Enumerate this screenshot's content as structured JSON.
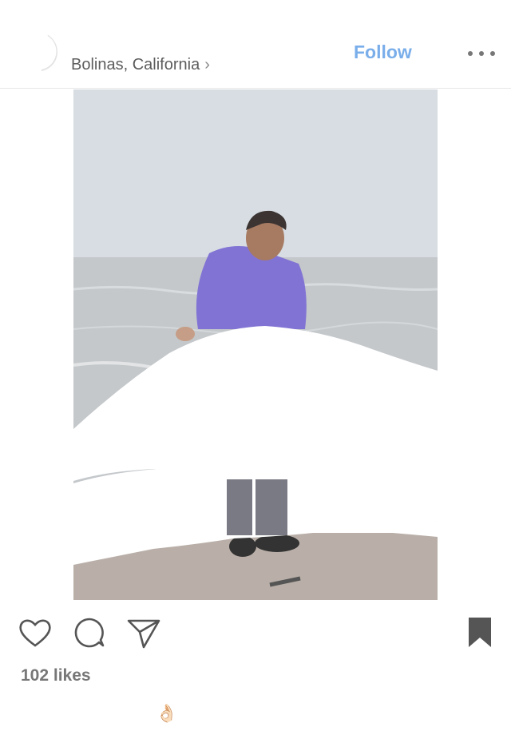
{
  "header": {
    "location": "Bolinas, California",
    "location_chevron": "›",
    "follow_label": "Follow",
    "more_icon": "more-horizontal-icon"
  },
  "post": {
    "likes": "102 likes",
    "caption_emoji": "👌🏻",
    "photo_description_icons": [
      "heart-icon",
      "comment-icon",
      "share-icon",
      "bookmark-icon"
    ]
  },
  "colors": {
    "follow": "#7aaeea",
    "hoodie": "#7f6ed6",
    "sky": "#d6dce3"
  }
}
